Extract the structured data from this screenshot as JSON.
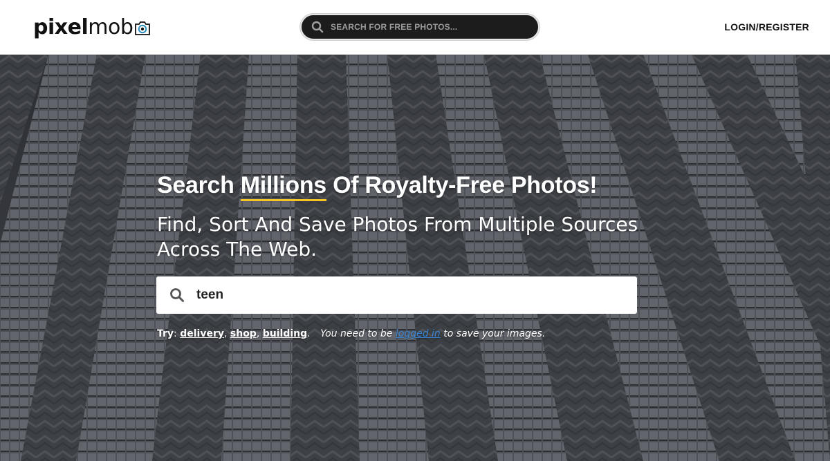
{
  "header": {
    "logo_bold": "pixel",
    "logo_light": "mob",
    "search_placeholder": "SEARCH FOR FREE PHOTOS...",
    "login_label": "LOGIN/REGISTER"
  },
  "hero": {
    "title_pre": "Search ",
    "title_highlight": "Millions",
    "title_post": " Of Royalty-Free Photos!",
    "subtitle": "Find, Sort And Save Photos From Multiple Sources Across The Web.",
    "search_value": "teen",
    "try_label": "Try",
    "suggestions": [
      "delivery",
      "shop",
      "building"
    ],
    "note_pre": "You need to be",
    "note_link": "logged in",
    "note_post": "to save your images."
  },
  "colors": {
    "accent_underline": "#f3c623",
    "link_blue": "#3a86d6",
    "header_search_bg": "#1c1c1c"
  },
  "icons": {
    "search": "search-icon",
    "camera": "camera-icon"
  }
}
